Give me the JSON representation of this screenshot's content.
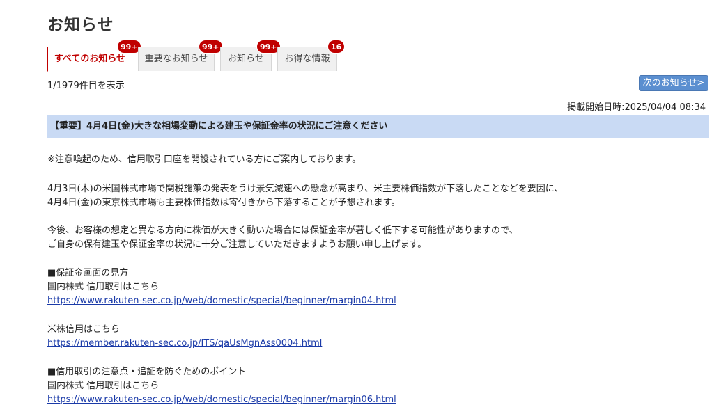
{
  "page": {
    "title": "お知らせ"
  },
  "tabs": [
    {
      "label": "すべてのお知らせ",
      "badge": "99+"
    },
    {
      "label": "重要なお知らせ",
      "badge": "99+"
    },
    {
      "label": "お知らせ",
      "badge": "99+"
    },
    {
      "label": "お得な情報",
      "badge": "16"
    }
  ],
  "list": {
    "count_text": "1/1979件目を表示",
    "next_label": "次のお知らせ>"
  },
  "notice": {
    "date_text": "掲載開始日時:2025/04/04 08:34",
    "headline": "【重要】4月4日(金)大きな相場変動による建玉や保証金率の状況にご注意ください",
    "p1": "※注意喚起のため、信用取引口座を開設されている方にご案内しております。",
    "p2_line1": "4月3日(木)の米国株式市場で関税施策の発表をうけ景気減速への懸念が高まり、米主要株価指数が下落したことなどを要因に、",
    "p2_line2": "4月4日(金)の東京株式市場も主要株価指数は寄付きから下落することが予想されます。",
    "p3_line1": "今後、お客様の想定と異なる方向に株価が大きく動いた場合には保証金率が著しく低下する可能性がありますので、",
    "p3_line2": "ご自身の保有建玉や保証金率の状況に十分ご注意していただきますようお願い申し上げます。",
    "s1_heading": "■保証金画面の見方",
    "s1_label": "国内株式 信用取引はこちら",
    "s1_link": "https://www.rakuten-sec.co.jp/web/domestic/special/beginner/margin04.html",
    "s2_label": "米株信用はこちら",
    "s2_link": "https://member.rakuten-sec.co.jp/ITS/qaUsMgnAss0004.html",
    "s3_heading": "■信用取引の注意点・追証を防ぐためのポイント",
    "s3_label": "国内株式 信用取引はこちら",
    "s3_link": "https://www.rakuten-sec.co.jp/web/domestic/special/beginner/margin06.html"
  },
  "colors": {
    "accent_red": "#c00000",
    "headline_bg": "#c9daf4",
    "button_blue": "#5b8fd0",
    "link_blue": "#1a3aa8"
  }
}
